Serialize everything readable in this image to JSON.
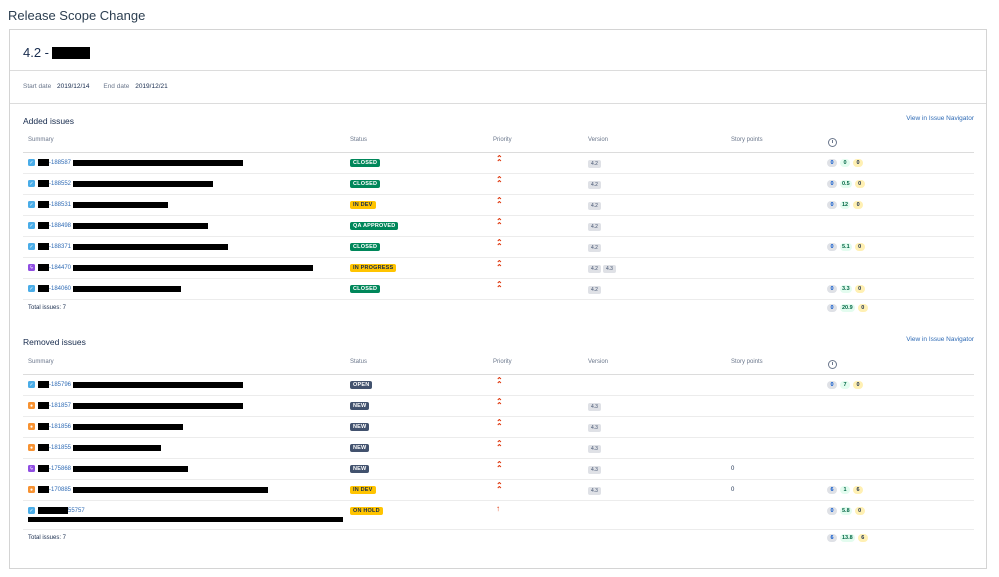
{
  "page_title": "Release Scope Change",
  "version": {
    "name": "4.2 -"
  },
  "dates": {
    "start_label": "Start date",
    "start_value": "2019/12/14",
    "end_label": "End date",
    "end_value": "2019/12/21"
  },
  "columns": {
    "summary": "Summary",
    "status": "Status",
    "priority": "Priority",
    "version": "Version",
    "story_points": "Story points",
    "time_icon": "clock-icon"
  },
  "added": {
    "title": "Added issues",
    "nav_link": "View in Issue Navigator",
    "rows": [
      {
        "type": "story",
        "key": "-188587",
        "status": "CLOSED",
        "status_kind": "done",
        "priority": "highest",
        "versions": [
          "4.2"
        ],
        "story_points": "",
        "time": [
          "0",
          "0",
          "0"
        ]
      },
      {
        "type": "story",
        "key": "-188552",
        "status": "CLOSED",
        "status_kind": "done",
        "priority": "highest",
        "versions": [
          "4.2"
        ],
        "story_points": "",
        "time": [
          "0",
          "0.5",
          "0"
        ]
      },
      {
        "type": "story",
        "key": "-188531",
        "status": "IN DEV",
        "status_kind": "prog",
        "priority": "highest",
        "versions": [
          "4.2"
        ],
        "story_points": "",
        "time": [
          "0",
          "12",
          "0"
        ]
      },
      {
        "type": "story",
        "key": "-188498",
        "status": "QA APPROVED",
        "status_kind": "done",
        "priority": "highest",
        "versions": [
          "4.2"
        ],
        "story_points": "",
        "time": []
      },
      {
        "type": "story",
        "key": "-188371",
        "status": "CLOSED",
        "status_kind": "done",
        "priority": "highest",
        "versions": [
          "4.2"
        ],
        "story_points": "",
        "time": [
          "0",
          "5.1",
          "0"
        ]
      },
      {
        "type": "epic",
        "key": "-184470",
        "status": "IN PROGRESS",
        "status_kind": "prog",
        "priority": "highest",
        "versions": [
          "4.2",
          "4.3"
        ],
        "story_points": "",
        "time": []
      },
      {
        "type": "story",
        "key": "-184060",
        "status": "CLOSED",
        "status_kind": "done",
        "priority": "highest",
        "versions": [
          "4.2"
        ],
        "story_points": "",
        "time": [
          "0",
          "3.3",
          "0"
        ]
      }
    ],
    "total_label": "Total issues: 7",
    "total_time": [
      "0",
      "20.9",
      "0"
    ]
  },
  "removed": {
    "title": "Removed issues",
    "nav_link": "View in Issue Navigator",
    "rows": [
      {
        "type": "story",
        "key": "-185796",
        "status": "OPEN",
        "status_kind": "new",
        "priority": "highest",
        "versions": [],
        "story_points": "",
        "time": [
          "0",
          "7",
          "0"
        ]
      },
      {
        "type": "bug",
        "key": "-181857",
        "status": "NEW",
        "status_kind": "new",
        "priority": "highest",
        "versions": [
          "4.3"
        ],
        "story_points": "",
        "time": []
      },
      {
        "type": "bug",
        "key": "-181856",
        "status": "NEW",
        "status_kind": "new",
        "priority": "highest",
        "versions": [
          "4.3"
        ],
        "story_points": "",
        "time": []
      },
      {
        "type": "bug",
        "key": "-181855",
        "status": "NEW",
        "status_kind": "new",
        "priority": "highest",
        "versions": [
          "4.3"
        ],
        "story_points": "",
        "time": []
      },
      {
        "type": "epic",
        "key": "-175868",
        "status": "NEW",
        "status_kind": "new",
        "priority": "highest",
        "versions": [
          "4.3"
        ],
        "story_points": "0",
        "time": []
      },
      {
        "type": "bug",
        "key": "-170885",
        "status": "IN DEV",
        "status_kind": "prog",
        "priority": "highest",
        "versions": [
          "4.3"
        ],
        "story_points": "0",
        "time": [
          "6",
          "1",
          "6"
        ]
      },
      {
        "type": "story",
        "key": "55757",
        "status": "ON HOLD",
        "status_kind": "prog",
        "priority": "high",
        "versions": [],
        "story_points": "",
        "time": [
          "0",
          "5.8",
          "0"
        ]
      }
    ],
    "total_label": "Total issues: 7",
    "total_time": [
      "6",
      "13.8",
      "6"
    ]
  }
}
